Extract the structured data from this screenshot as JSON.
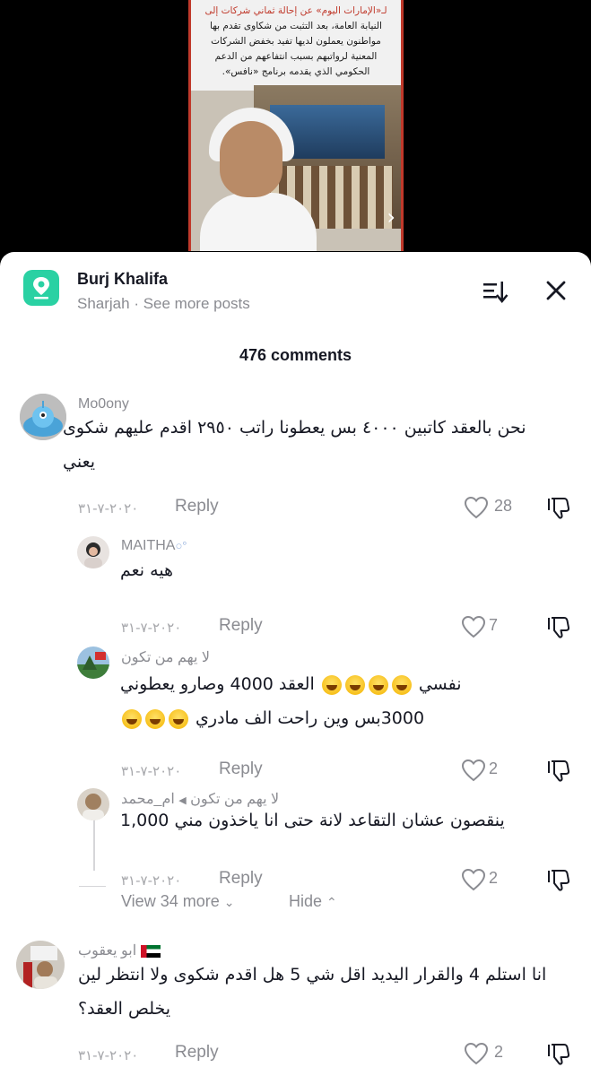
{
  "video_caption": {
    "line1": "لـ«الإمارات اليوم» عن إحالة ثماني شركات إلى",
    "line1_red": "لـ«الإمارات اليوم»",
    "line2": "النيابة العامة، بعد التثبت من شكاوى تقدم بها",
    "line3": "مواطنون يعملون لديها تفيد بخفض الشركات",
    "line4": "المعنية لرواتبهم بسبب انتفاعهم من الدعم",
    "line5": "الحكومي الذي يقدمه برنامج «نافس»."
  },
  "header": {
    "title": "Burj Khalifa",
    "subtitle": "Sharjah · See more posts",
    "comment_count": "476 comments"
  },
  "colors": {
    "accent": "#2ad1a3",
    "text": "#161823",
    "muted": "#8a8b91"
  },
  "comments": [
    {
      "user": "Mo0ony",
      "text_line1": "نحن بالعقد كاتبين ٤٠٠٠ بس يعطونا راتب ٢٩٥٠ اقدم عليهم شكوى",
      "text_line2": "يعني",
      "date": "٢٠٢٠-٧-٣١",
      "reply": "Reply",
      "likes": "28"
    },
    {
      "user": "MAITHA",
      "text_line1": "هيه نعم",
      "date": "٢٠٢٠-٧-٣١",
      "reply": "Reply",
      "likes": "7"
    },
    {
      "user": "لا يهم من تكون",
      "text_line1": "نفسي",
      "text_line1b": "العقد 4000 وصارو يعطوني",
      "text_line2": "3000بس وين راحت الف مادري",
      "date": "٢٠٢٠-٧-٣١",
      "reply": "Reply",
      "likes": "2"
    },
    {
      "user": "ام_محمد",
      "reply_to": "لا يهم من تكون",
      "text_line1": "ينقصون عشان التقاعد لانة حتى انا ياخذون مني 1,000",
      "date": "٢٠٢٠-٧-٣١",
      "reply": "Reply",
      "likes": "2"
    },
    {
      "user": "ابو يعقوب",
      "text_line1": "انا استلم 4 والقرار اليديد اقل شي 5 هل اقدم شكوى ولا انتظر لين",
      "text_line2": "يخلص العقد؟",
      "date": "٢٠٢٠-٧-٣١",
      "reply": "Reply",
      "likes": "2"
    }
  ],
  "thread": {
    "view_more": "View 34 more",
    "hide": "Hide"
  }
}
